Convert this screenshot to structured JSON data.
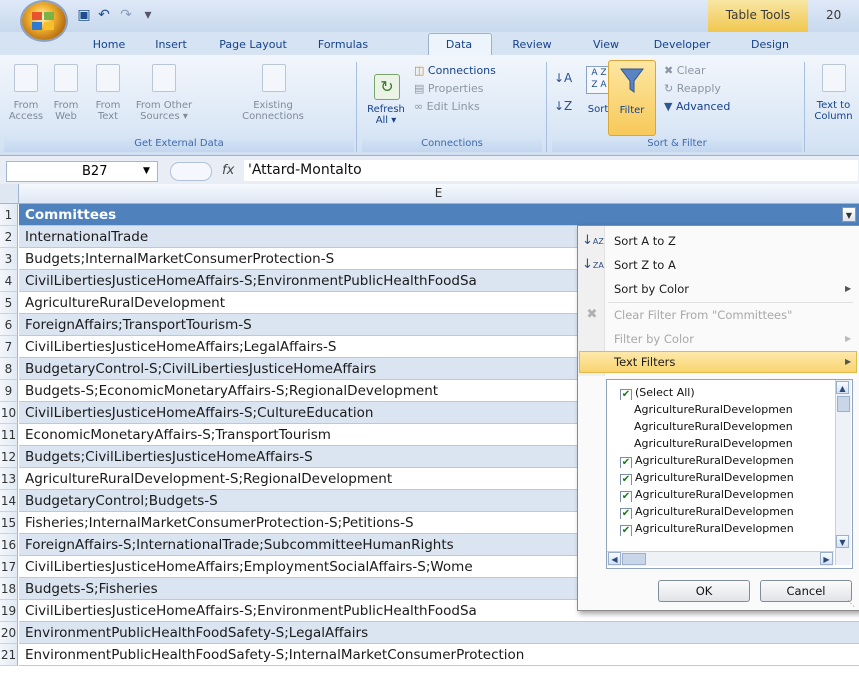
{
  "titlebar": {
    "context_tab": "Table Tools",
    "title_tail": "20"
  },
  "tabs": [
    "Home",
    "Insert",
    "Page Layout",
    "Formulas",
    "Data",
    "Review",
    "View",
    "Developer",
    "Design"
  ],
  "ribbon": {
    "get_external": {
      "buttons": [
        {
          "l1": "From",
          "l2": "Access"
        },
        {
          "l1": "From",
          "l2": "Web"
        },
        {
          "l1": "From",
          "l2": "Text"
        },
        {
          "l1": "From Other",
          "l2": "Sources ▾"
        },
        {
          "l1": "Existing",
          "l2": "Connections"
        }
      ],
      "label": "Get External Data"
    },
    "connections": {
      "refresh_l1": "Refresh",
      "refresh_l2": "All ▾",
      "items": [
        "Connections",
        "Properties",
        "Edit Links"
      ],
      "label": "Connections"
    },
    "sort_filter": {
      "sort": "Sort",
      "filter": "Filter",
      "clear": "Clear",
      "reapply": "Reapply",
      "advanced": "Advanced",
      "label": "Sort & Filter"
    },
    "text_to_columns": {
      "l1": "Text to",
      "l2": "Column"
    }
  },
  "formula": {
    "namebox": "B27",
    "fx": "fx",
    "value": "'Attard-Montalto"
  },
  "grid": {
    "column_letter": "E",
    "rows": [
      {
        "n": "1",
        "text": "Committees"
      },
      {
        "n": "2",
        "text": "InternationalTrade"
      },
      {
        "n": "3",
        "text": "Budgets;InternalMarketConsumerProtection-S"
      },
      {
        "n": "4",
        "text": "CivilLibertiesJusticeHomeAffairs-S;EnvironmentPublicHealthFoodSa"
      },
      {
        "n": "5",
        "text": "AgricultureRuralDevelopment"
      },
      {
        "n": "6",
        "text": "ForeignAffairs;TransportTourism-S"
      },
      {
        "n": "7",
        "text": "CivilLibertiesJusticeHomeAffairs;LegalAffairs-S"
      },
      {
        "n": "8",
        "text": "BudgetaryControl-S;CivilLibertiesJusticeHomeAffairs"
      },
      {
        "n": "9",
        "text": "Budgets-S;EconomicMonetaryAffairs-S;RegionalDevelopment"
      },
      {
        "n": "10",
        "text": "CivilLibertiesJusticeHomeAffairs-S;CultureEducation"
      },
      {
        "n": "11",
        "text": "EconomicMonetaryAffairs-S;TransportTourism"
      },
      {
        "n": "12",
        "text": "Budgets;CivilLibertiesJusticeHomeAffairs-S"
      },
      {
        "n": "13",
        "text": "AgricultureRuralDevelopment-S;RegionalDevelopment"
      },
      {
        "n": "14",
        "text": "BudgetaryControl;Budgets-S"
      },
      {
        "n": "15",
        "text": "Fisheries;InternalMarketConsumerProtection-S;Petitions-S"
      },
      {
        "n": "16",
        "text": "ForeignAffairs-S;InternationalTrade;SubcommitteeHumanRights"
      },
      {
        "n": "17",
        "text": "CivilLibertiesJusticeHomeAffairs;EmploymentSocialAffairs-S;Wome"
      },
      {
        "n": "18",
        "text": "Budgets-S;Fisheries"
      },
      {
        "n": "19",
        "text": "CivilLibertiesJusticeHomeAffairs-S;EnvironmentPublicHealthFoodSa"
      },
      {
        "n": "20",
        "text": "EnvironmentPublicHealthFoodSafety-S;LegalAffairs"
      },
      {
        "n": "21",
        "text": "EnvironmentPublicHealthFoodSafety-S;InternalMarketConsumerProtection"
      }
    ]
  },
  "dropdown": {
    "sort_az": "Sort A to Z",
    "sort_za": "Sort Z to A",
    "sort_color": "Sort by Color",
    "clear_filter": "Clear Filter From \"Committees\"",
    "filter_color": "Filter by Color",
    "text_filters": "Text Filters",
    "checklist": [
      {
        "label": "(Select All)",
        "checked": true
      },
      {
        "label": "AgricultureRuralDevelopmen",
        "checked": false
      },
      {
        "label": "AgricultureRuralDevelopmen",
        "checked": false
      },
      {
        "label": "AgricultureRuralDevelopmen",
        "checked": false
      },
      {
        "label": "AgricultureRuralDevelopmen",
        "checked": true
      },
      {
        "label": "AgricultureRuralDevelopmen",
        "checked": true
      },
      {
        "label": "AgricultureRuralDevelopmen",
        "checked": true
      },
      {
        "label": "AgricultureRuralDevelopmen",
        "checked": true
      },
      {
        "label": "AgricultureRuralDevelopmen",
        "checked": true
      }
    ],
    "ok": "OK",
    "cancel": "Cancel"
  }
}
